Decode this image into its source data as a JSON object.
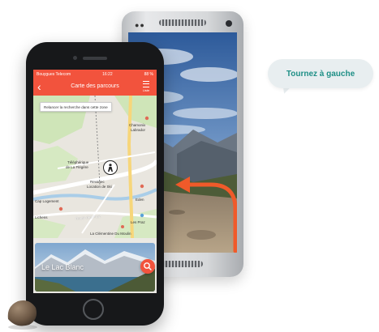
{
  "tooltip": {
    "text": "Tournez à gauche"
  },
  "front_phone": {
    "status_bar": {
      "carrier": "Bouygues Telecom",
      "time": "16:22",
      "battery": "88 %"
    },
    "nav": {
      "title": "Carte des parcours",
      "list_label": "Liste"
    },
    "map": {
      "search_area_button": "Relancer la recherche dans cette zone",
      "labels": {
        "chamonix": "Chamonix",
        "labrador": "Labrador",
        "telepherique": "Téléphérique",
        "la_flegere": "de La Flégère",
        "revanec": "Revanec",
        "location_ski": "Location de Ski",
        "cap_logement": "Cap Logement",
        "eden": "Eden",
        "lichens": "Lichens",
        "route_praz": "Route des Praz",
        "les_praz": "Les Praz",
        "clementine": "La Clémentine Du Moulin"
      }
    },
    "card": {
      "title": "Le Lac Blanc"
    }
  },
  "colors": {
    "accent": "#f2533d",
    "bubble_text": "#1e8f86",
    "bubble_bg": "#e8eef0",
    "direction_arrow": "#f05a2a"
  }
}
